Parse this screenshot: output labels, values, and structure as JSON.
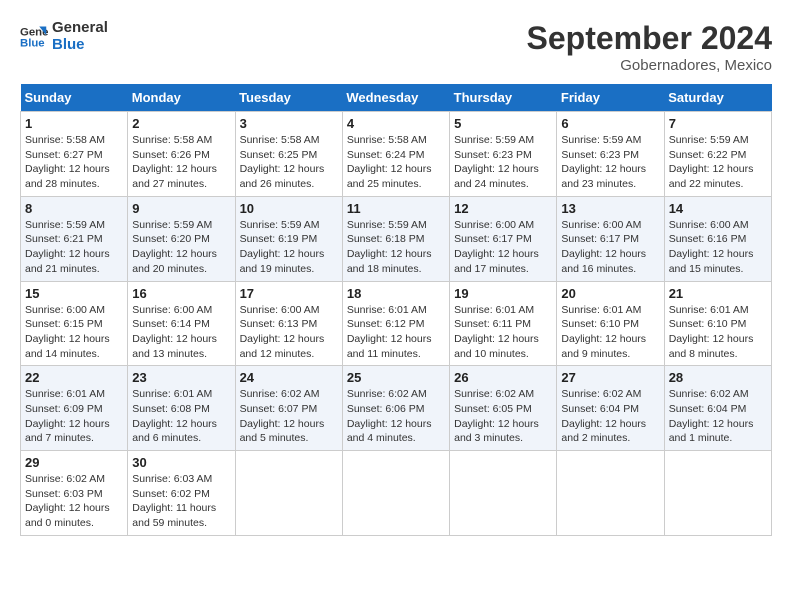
{
  "header": {
    "logo_line1": "General",
    "logo_line2": "Blue",
    "month": "September 2024",
    "location": "Gobernadores, Mexico"
  },
  "days_of_week": [
    "Sunday",
    "Monday",
    "Tuesday",
    "Wednesday",
    "Thursday",
    "Friday",
    "Saturday"
  ],
  "weeks": [
    [
      {
        "num": "1",
        "info": "Sunrise: 5:58 AM\nSunset: 6:27 PM\nDaylight: 12 hours\nand 28 minutes."
      },
      {
        "num": "2",
        "info": "Sunrise: 5:58 AM\nSunset: 6:26 PM\nDaylight: 12 hours\nand 27 minutes."
      },
      {
        "num": "3",
        "info": "Sunrise: 5:58 AM\nSunset: 6:25 PM\nDaylight: 12 hours\nand 26 minutes."
      },
      {
        "num": "4",
        "info": "Sunrise: 5:58 AM\nSunset: 6:24 PM\nDaylight: 12 hours\nand 25 minutes."
      },
      {
        "num": "5",
        "info": "Sunrise: 5:59 AM\nSunset: 6:23 PM\nDaylight: 12 hours\nand 24 minutes."
      },
      {
        "num": "6",
        "info": "Sunrise: 5:59 AM\nSunset: 6:23 PM\nDaylight: 12 hours\nand 23 minutes."
      },
      {
        "num": "7",
        "info": "Sunrise: 5:59 AM\nSunset: 6:22 PM\nDaylight: 12 hours\nand 22 minutes."
      }
    ],
    [
      {
        "num": "8",
        "info": "Sunrise: 5:59 AM\nSunset: 6:21 PM\nDaylight: 12 hours\nand 21 minutes."
      },
      {
        "num": "9",
        "info": "Sunrise: 5:59 AM\nSunset: 6:20 PM\nDaylight: 12 hours\nand 20 minutes."
      },
      {
        "num": "10",
        "info": "Sunrise: 5:59 AM\nSunset: 6:19 PM\nDaylight: 12 hours\nand 19 minutes."
      },
      {
        "num": "11",
        "info": "Sunrise: 5:59 AM\nSunset: 6:18 PM\nDaylight: 12 hours\nand 18 minutes."
      },
      {
        "num": "12",
        "info": "Sunrise: 6:00 AM\nSunset: 6:17 PM\nDaylight: 12 hours\nand 17 minutes."
      },
      {
        "num": "13",
        "info": "Sunrise: 6:00 AM\nSunset: 6:17 PM\nDaylight: 12 hours\nand 16 minutes."
      },
      {
        "num": "14",
        "info": "Sunrise: 6:00 AM\nSunset: 6:16 PM\nDaylight: 12 hours\nand 15 minutes."
      }
    ],
    [
      {
        "num": "15",
        "info": "Sunrise: 6:00 AM\nSunset: 6:15 PM\nDaylight: 12 hours\nand 14 minutes."
      },
      {
        "num": "16",
        "info": "Sunrise: 6:00 AM\nSunset: 6:14 PM\nDaylight: 12 hours\nand 13 minutes."
      },
      {
        "num": "17",
        "info": "Sunrise: 6:00 AM\nSunset: 6:13 PM\nDaylight: 12 hours\nand 12 minutes."
      },
      {
        "num": "18",
        "info": "Sunrise: 6:01 AM\nSunset: 6:12 PM\nDaylight: 12 hours\nand 11 minutes."
      },
      {
        "num": "19",
        "info": "Sunrise: 6:01 AM\nSunset: 6:11 PM\nDaylight: 12 hours\nand 10 minutes."
      },
      {
        "num": "20",
        "info": "Sunrise: 6:01 AM\nSunset: 6:10 PM\nDaylight: 12 hours\nand 9 minutes."
      },
      {
        "num": "21",
        "info": "Sunrise: 6:01 AM\nSunset: 6:10 PM\nDaylight: 12 hours\nand 8 minutes."
      }
    ],
    [
      {
        "num": "22",
        "info": "Sunrise: 6:01 AM\nSunset: 6:09 PM\nDaylight: 12 hours\nand 7 minutes."
      },
      {
        "num": "23",
        "info": "Sunrise: 6:01 AM\nSunset: 6:08 PM\nDaylight: 12 hours\nand 6 minutes."
      },
      {
        "num": "24",
        "info": "Sunrise: 6:02 AM\nSunset: 6:07 PM\nDaylight: 12 hours\nand 5 minutes."
      },
      {
        "num": "25",
        "info": "Sunrise: 6:02 AM\nSunset: 6:06 PM\nDaylight: 12 hours\nand 4 minutes."
      },
      {
        "num": "26",
        "info": "Sunrise: 6:02 AM\nSunset: 6:05 PM\nDaylight: 12 hours\nand 3 minutes."
      },
      {
        "num": "27",
        "info": "Sunrise: 6:02 AM\nSunset: 6:04 PM\nDaylight: 12 hours\nand 2 minutes."
      },
      {
        "num": "28",
        "info": "Sunrise: 6:02 AM\nSunset: 6:04 PM\nDaylight: 12 hours\nand 1 minute."
      }
    ],
    [
      {
        "num": "29",
        "info": "Sunrise: 6:02 AM\nSunset: 6:03 PM\nDaylight: 12 hours\nand 0 minutes."
      },
      {
        "num": "30",
        "info": "Sunrise: 6:03 AM\nSunset: 6:02 PM\nDaylight: 11 hours\nand 59 minutes."
      },
      {
        "num": "",
        "info": ""
      },
      {
        "num": "",
        "info": ""
      },
      {
        "num": "",
        "info": ""
      },
      {
        "num": "",
        "info": ""
      },
      {
        "num": "",
        "info": ""
      }
    ]
  ]
}
